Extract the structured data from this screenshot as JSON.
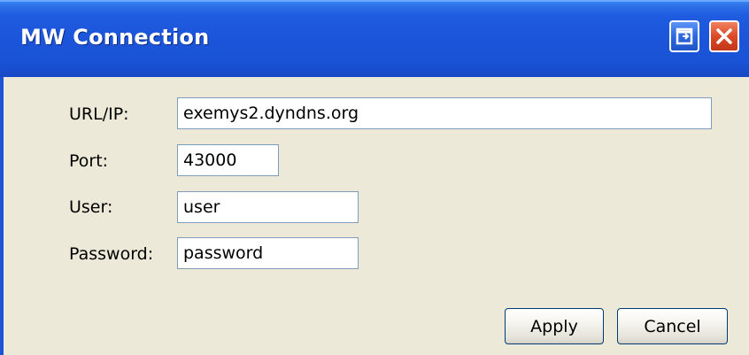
{
  "window": {
    "title": "MW Connection",
    "controls": {
      "restore_icon": "restore-icon",
      "close_icon": "close-icon"
    }
  },
  "form": {
    "url": {
      "label": "URL/IP:",
      "value": "exemys2.dyndns.org"
    },
    "port": {
      "label": "Port:",
      "value": "43000"
    },
    "user": {
      "label": "User:",
      "value": "user"
    },
    "password": {
      "label": "Password:",
      "value": "password"
    }
  },
  "buttons": {
    "apply": "Apply",
    "cancel": "Cancel"
  },
  "colors": {
    "titlebar": "#1b54d8",
    "close_button": "#dc4a26",
    "window_bg": "#ece9d8",
    "input_border": "#7f9db9"
  }
}
